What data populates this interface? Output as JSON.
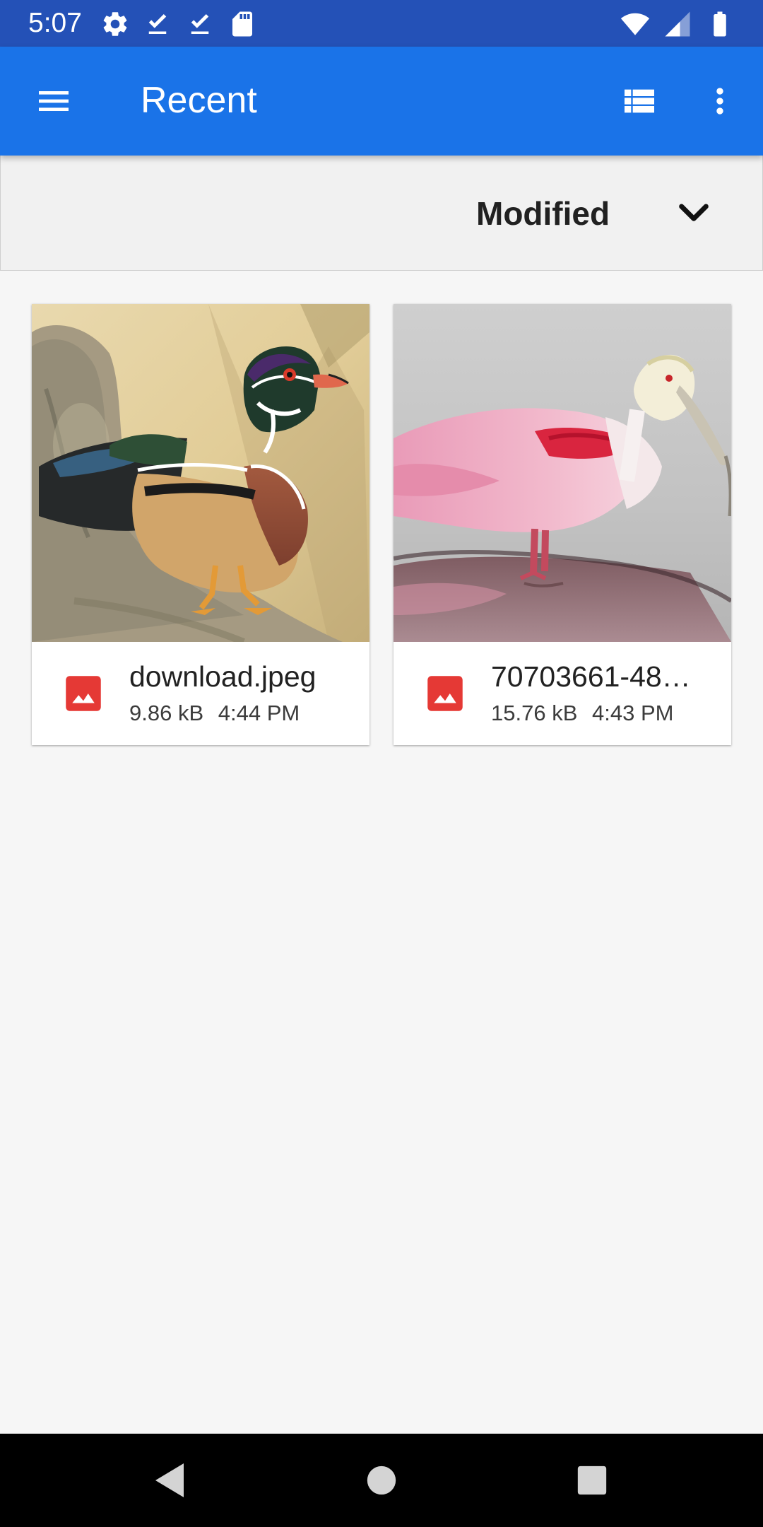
{
  "status_bar": {
    "time": "5:07",
    "left_icons": [
      "settings-icon",
      "download-done-icon",
      "download-done-icon",
      "sd-card-icon"
    ],
    "right_icons": [
      "wifi-icon",
      "signal-icon",
      "battery-icon"
    ]
  },
  "app_bar": {
    "title": "Recent",
    "menu_icon": "menu-icon",
    "list_view_icon": "list-view-icon",
    "overflow_icon": "more-vert-icon",
    "background": "#1a73e8"
  },
  "sort": {
    "label": "Modified",
    "icon": "chevron-down-icon"
  },
  "files": [
    {
      "name": "download.jpeg",
      "size": "9.86 kB",
      "time": "4:44 PM",
      "type_icon": "image-file-icon",
      "thumbnail": "wood-duck-photo"
    },
    {
      "name": "70703661-48…",
      "size": "15.76 kB",
      "time": "4:43 PM",
      "type_icon": "image-file-icon",
      "thumbnail": "roseate-spoonbill-photo"
    }
  ],
  "colors": {
    "status_bar": "#2451b7",
    "image_icon": "#e53935",
    "page_bg": "#f6f6f6"
  },
  "nav_bar": {
    "buttons": [
      "back-icon",
      "home-icon",
      "recents-icon"
    ]
  }
}
